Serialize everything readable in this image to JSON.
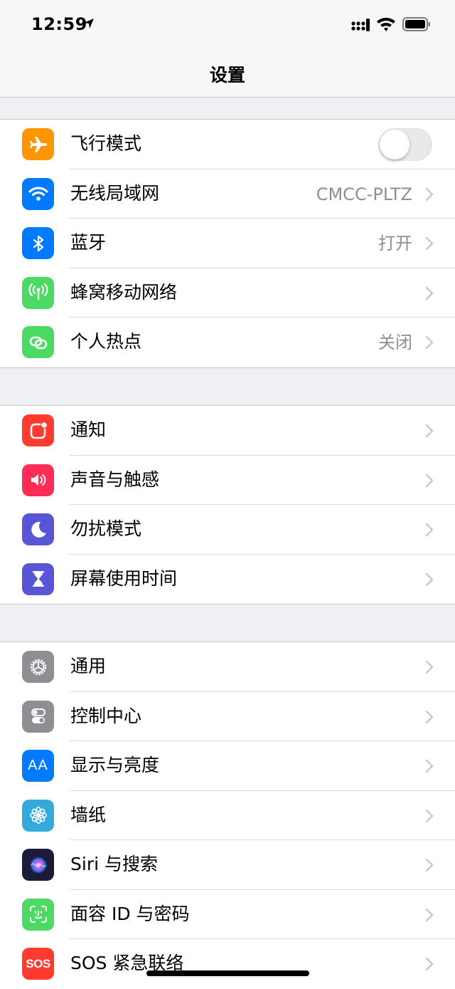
{
  "status_bar": {
    "time": "12:59",
    "icons": [
      "location-arrow-icon",
      "cellular-signal-icon",
      "wifi-icon",
      "battery-icon"
    ]
  },
  "nav": {
    "title": "设置"
  },
  "colors": {
    "orange": "#ff9500",
    "blue": "#007aff",
    "green": "#4cd964",
    "red": "#ff3b30",
    "pink": "#ff2d55",
    "purple": "#5856d6",
    "gray": "#8e8e93",
    "cyan": "#34aadc",
    "siri_dark": "#1c1c3a"
  },
  "groups": [
    {
      "rows": [
        {
          "label": "飞行模式",
          "icon": "airplane-icon",
          "toggle": "off"
        },
        {
          "label": "无线局域网",
          "icon": "wifi-icon",
          "value": "CMCC-PLTZ"
        },
        {
          "label": "蓝牙",
          "icon": "bluetooth-icon",
          "value": "打开"
        },
        {
          "label": "蜂窝移动网络",
          "icon": "cellular-antenna-icon"
        },
        {
          "label": "个人热点",
          "icon": "hotspot-link-icon",
          "value": "关闭"
        }
      ]
    },
    {
      "rows": [
        {
          "label": "通知",
          "icon": "notifications-icon"
        },
        {
          "label": "声音与触感",
          "icon": "speaker-icon"
        },
        {
          "label": "勿扰模式",
          "icon": "moon-icon"
        },
        {
          "label": "屏幕使用时间",
          "icon": "hourglass-icon"
        }
      ]
    },
    {
      "rows": [
        {
          "label": "通用",
          "icon": "gear-icon"
        },
        {
          "label": "控制中心",
          "icon": "switches-icon"
        },
        {
          "label": "显示与亮度",
          "icon": "text-size-icon",
          "icon_text": "AA"
        },
        {
          "label": "墙纸",
          "icon": "flower-icon"
        },
        {
          "label": "Siri 与搜索",
          "icon": "siri-icon"
        },
        {
          "label": "面容 ID 与密码",
          "icon": "face-id-icon"
        },
        {
          "label": "SOS 紧急联络",
          "icon": "sos-icon",
          "icon_text": "SOS"
        }
      ]
    }
  ]
}
